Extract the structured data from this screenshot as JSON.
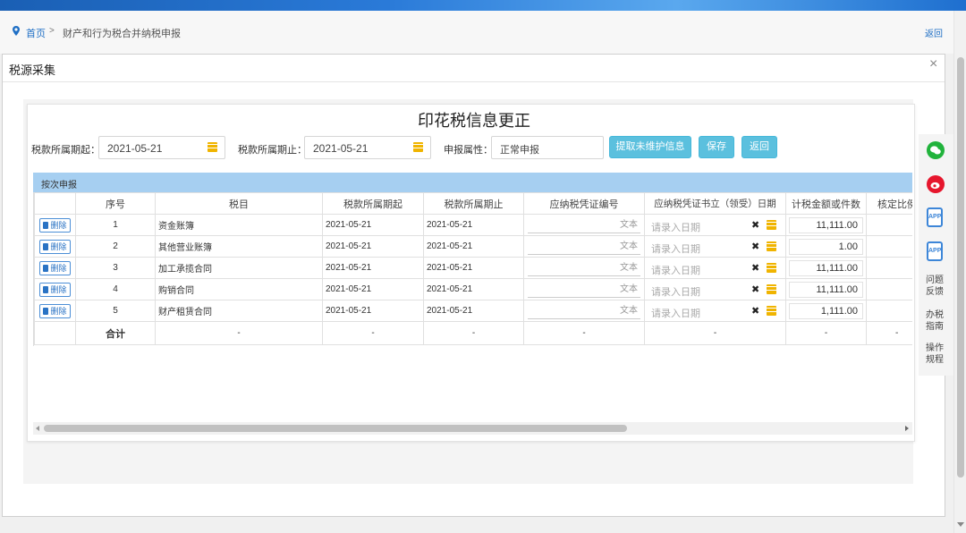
{
  "breadcrumb": {
    "home": "首页",
    "separator": ">",
    "current": "财产和行为税合并纳税申报",
    "back": "返回"
  },
  "modal": {
    "title": "税源采集",
    "close": "×"
  },
  "form": {
    "title": "印花税信息更正",
    "start_label": "税款所属期起：",
    "start_value": "2021-05-21",
    "end_label": "税款所属期止：",
    "end_value": "2021-05-21",
    "attr_label": "申报属性：",
    "attr_value": "正常申报",
    "buttons": {
      "fetch": "提取未维护信息",
      "save": "保存",
      "back": "返回"
    }
  },
  "section": {
    "title": "按次申报"
  },
  "table": {
    "headers": [
      "",
      "序号",
      "税目",
      "税款所属期起",
      "税款所属期止",
      "应纳税凭证编号",
      "应纳税凭证书立（领受）日期",
      "计税金额或件数",
      "核定比例"
    ],
    "delete_label": "删除",
    "text_placeholder": "文本",
    "date_placeholder": "请录入日期",
    "rows": [
      {
        "no": "1",
        "item": "资金账簿",
        "start": "2021-05-21",
        "end": "2021-05-21",
        "amount": "11,111.00"
      },
      {
        "no": "2",
        "item": "其他营业账簿",
        "start": "2021-05-21",
        "end": "2021-05-21",
        "amount": "1.00"
      },
      {
        "no": "3",
        "item": "加工承揽合同",
        "start": "2021-05-21",
        "end": "2021-05-21",
        "amount": "11,111.00"
      },
      {
        "no": "4",
        "item": "购销合同",
        "start": "2021-05-21",
        "end": "2021-05-21",
        "amount": "11,111.00"
      },
      {
        "no": "5",
        "item": "财产租赁合同",
        "start": "2021-05-21",
        "end": "2021-05-21",
        "amount": "1,111.00"
      }
    ],
    "total": {
      "label": "合计",
      "dash": "-"
    }
  },
  "sidebar": {
    "app_label": "APP",
    "feedback": "问题反馈",
    "guide": "办税指南",
    "procedure": "操作规程"
  },
  "icons": [
    "location-pin-icon",
    "calendar-icon",
    "trash-icon",
    "clear-icon",
    "wechat-icon",
    "weibo-icon",
    "app-icon"
  ],
  "colors": {
    "accent": "#5bc0de",
    "section_header": "#a6cff1",
    "link": "#1f6fc5",
    "calendar": "#f0b400"
  }
}
